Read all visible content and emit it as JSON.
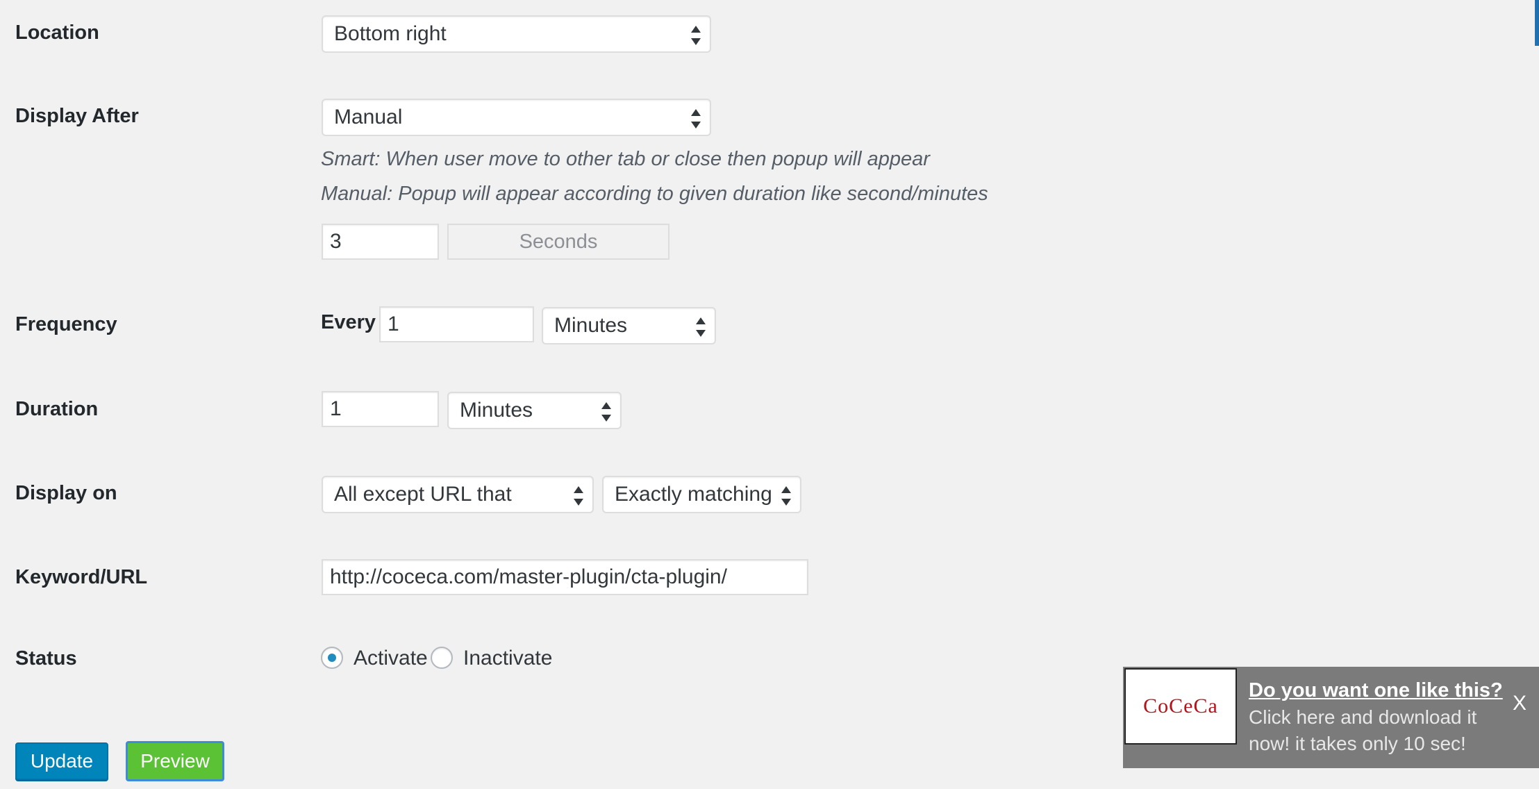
{
  "form": {
    "location": {
      "label": "Location",
      "selected": "Bottom right"
    },
    "display_after": {
      "label": "Display After",
      "selected": "Manual",
      "hint_smart": "Smart: When user move to other tab or close then popup will appear",
      "hint_manual": "Manual: Popup will appear according to given duration like second/minutes",
      "value": "3",
      "unit": "Seconds"
    },
    "frequency": {
      "label": "Frequency",
      "prefix": "Every",
      "value": "1",
      "unit_selected": "Minutes"
    },
    "duration": {
      "label": "Duration",
      "value": "1",
      "unit_selected": "Minutes"
    },
    "display_on": {
      "label": "Display on",
      "scope_selected": "All except URL that",
      "match_selected": "Exactly matching"
    },
    "keyword_url": {
      "label": "Keyword/URL",
      "value": "http://coceca.com/master-plugin/cta-plugin/"
    },
    "status": {
      "label": "Status",
      "options": [
        "Activate",
        "Inactivate"
      ],
      "selected": "Activate"
    }
  },
  "buttons": {
    "update_label": "Update",
    "preview_label": "Preview"
  },
  "popup": {
    "logo_text": "CoCeCa",
    "title": "Do you want one like this?",
    "body": "Click here and download it now! it takes only 10 sec!",
    "close_label": "X"
  },
  "colors": {
    "background": "#f1f1f1",
    "primary_button": "#0085ba",
    "preview_button": "#5bc236",
    "radio_checked": "#1e8cbe",
    "popup_background": "#7b7b7b",
    "logo_text": "#b3141c"
  }
}
